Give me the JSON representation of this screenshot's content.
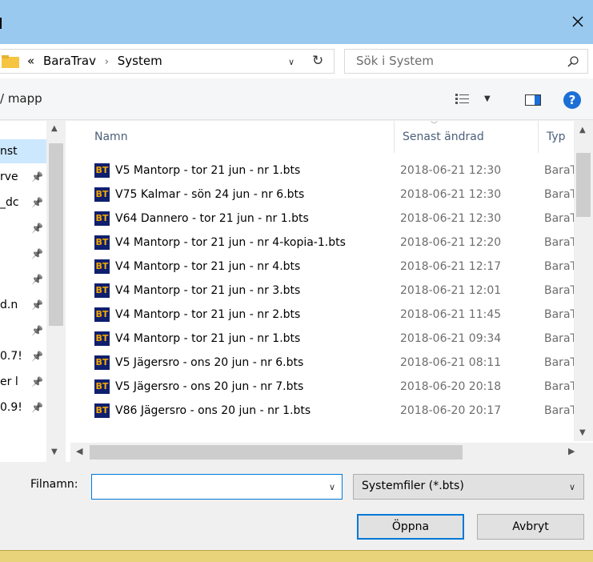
{
  "window": {
    "close_glyph": "✕"
  },
  "address": {
    "overflow": "«",
    "crumbs": [
      "BaraTrav",
      "System"
    ],
    "search_placeholder": "Sök i System"
  },
  "toolbar": {
    "new_folder_label": "/ mapp",
    "help_label": "?"
  },
  "nav": {
    "items": [
      {
        "label": "nst",
        "pinned": false,
        "selected": true
      },
      {
        "label": "rve",
        "pinned": true
      },
      {
        "label": "_dc",
        "pinned": true
      },
      {
        "label": "",
        "pinned": true
      },
      {
        "label": "",
        "pinned": true
      },
      {
        "label": "",
        "pinned": true
      },
      {
        "label": "d.n",
        "pinned": true
      },
      {
        "label": "",
        "pinned": true
      },
      {
        "label": "0.7!",
        "pinned": true
      },
      {
        "label": "er l",
        "pinned": true
      },
      {
        "label": "0.9!",
        "pinned": true
      }
    ]
  },
  "columns": {
    "name": "Namn",
    "modified": "Senast ändrad",
    "type": "Typ"
  },
  "files": [
    {
      "icon": "BT",
      "name": "V5 Mantorp - tor 21 jun - nr 1.bts",
      "modified": "2018-06-21 12:30",
      "type": "BaraT"
    },
    {
      "icon": "BT",
      "name": "V75 Kalmar - sön 24 jun - nr 6.bts",
      "modified": "2018-06-21 12:30",
      "type": "BaraT"
    },
    {
      "icon": "BT",
      "name": "V64 Dannero - tor 21 jun - nr 1.bts",
      "modified": "2018-06-21 12:30",
      "type": "BaraT"
    },
    {
      "icon": "BT",
      "name": "V4 Mantorp - tor 21 jun - nr 4-kopia-1.bts",
      "modified": "2018-06-21 12:20",
      "type": "BaraT"
    },
    {
      "icon": "BT",
      "name": "V4 Mantorp - tor 21 jun - nr 4.bts",
      "modified": "2018-06-21 12:17",
      "type": "BaraT"
    },
    {
      "icon": "BT",
      "name": "V4 Mantorp - tor 21 jun - nr 3.bts",
      "modified": "2018-06-21 12:01",
      "type": "BaraT"
    },
    {
      "icon": "BT",
      "name": "V4 Mantorp - tor 21 jun - nr 2.bts",
      "modified": "2018-06-21 11:45",
      "type": "BaraT"
    },
    {
      "icon": "BT",
      "name": "V4 Mantorp - tor 21 jun - nr 1.bts",
      "modified": "2018-06-21 09:34",
      "type": "BaraT"
    },
    {
      "icon": "BT",
      "name": "V5 Jägersro - ons 20 jun - nr 6.bts",
      "modified": "2018-06-21 08:11",
      "type": "BaraT"
    },
    {
      "icon": "BT",
      "name": "V5 Jägersro - ons 20 jun - nr 7.bts",
      "modified": "2018-06-20 20:18",
      "type": "BaraT"
    },
    {
      "icon": "BT",
      "name": "V86 Jägersro - ons 20 jun - nr 1.bts",
      "modified": "2018-06-20 20:17",
      "type": "BaraT"
    }
  ],
  "bottom": {
    "filename_label": "Filnamn:",
    "filename_value": "",
    "filter_value": "Systemfiler (*.bts)",
    "open_label": "Öppna",
    "cancel_label": "Avbryt"
  },
  "colors": {
    "titlebar": "#99c9ef",
    "accent": "#0078d7",
    "selection": "#cce8ff"
  }
}
